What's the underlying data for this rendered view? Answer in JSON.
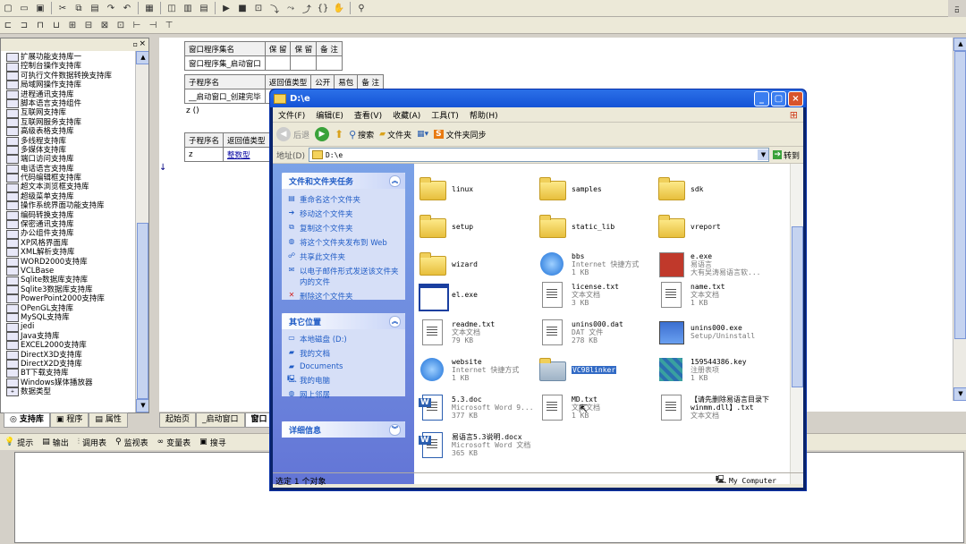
{
  "ide": {
    "tree_items": [
      "扩展功能支持库一",
      "控制台操作支持库",
      "可执行文件数据转换支持库",
      "局域网操作支持库",
      "进程通讯支持库",
      "脚本语言支持组件",
      "互联网支持库",
      "互联网服务支持库",
      "高级表格支持库",
      "多线程支持库",
      "多媒体支持库",
      "端口访问支持库",
      "电话语言支持库",
      "代码编辑框支持库",
      "超文本浏览框支持库",
      "超级菜单支持库",
      "操作系统界面功能支持库",
      "编码转换支持库",
      "保密通讯支持库",
      "办公组件支持库",
      "XP风格界面库",
      "XML解析支持库",
      "WORD2000支持库",
      "VCLBase",
      "Sqlite数据库支持库",
      "Sqlite3数据库支持库",
      "PowerPoint2000支持库",
      "OPenGL支持库",
      "MySQL支持库",
      "jedi",
      "Java支持库",
      "EXCEL2000支持库",
      "DirectX3D支持库",
      "DirectX2D支持库",
      "BT下载支持库",
      "Windows媒体播放器",
      "数据类型"
    ],
    "left_tabs": [
      "支持库",
      "程序",
      "属性"
    ],
    "code_tabs": [
      "起始页",
      "_启动窗口",
      "窗口"
    ],
    "table1": {
      "h": [
        "窗口程序集名",
        "保 留",
        "保 留",
        "备 注"
      ],
      "r": [
        "窗口程序集_启动窗口",
        "",
        "",
        ""
      ]
    },
    "table2": {
      "h": [
        "子程序名",
        "返回值类型",
        "公开",
        "易包",
        "备 注"
      ],
      "r": [
        "__启动窗口_创建完毕",
        "",
        "",
        "",
        ""
      ]
    },
    "code_line": "z ()",
    "table3": {
      "h": [
        "子程序名",
        "返回值类型"
      ],
      "r": [
        "z",
        "整数型"
      ]
    },
    "bottom_tabs": [
      "提示",
      "输出",
      "调用表",
      "监视表",
      "变量表",
      "搜寻"
    ]
  },
  "explorer": {
    "title": "D:\\e",
    "menu": [
      "文件(F)",
      "编辑(E)",
      "查看(V)",
      "收藏(A)",
      "工具(T)",
      "帮助(H)"
    ],
    "toolbar": {
      "back": "后退",
      "search": "搜索",
      "folders": "文件夹",
      "sync": "文件夹同步"
    },
    "address_label": "地址(D)",
    "address_value": "D:\\e",
    "go": "转到",
    "tasks_title": "文件和文件夹任务",
    "tasks": [
      "重命名这个文件夹",
      "移动这个文件夹",
      "复制这个文件夹",
      "将这个文件夹发布到 Web",
      "共享此文件夹",
      "以电子邮件形式发送该文件夹内的文件",
      "删除这个文件夹"
    ],
    "places_title": "其它位置",
    "places": [
      "本地磁盘 (D:)",
      "我的文档",
      "Documents",
      "我的电脑",
      "网上邻居"
    ],
    "details_title": "详细信息",
    "files": [
      {
        "n": "linux",
        "s1": "",
        "s2": "",
        "t": "folder"
      },
      {
        "n": "samples",
        "s1": "",
        "s2": "",
        "t": "folder"
      },
      {
        "n": "sdk",
        "s1": "",
        "s2": "",
        "t": "folder"
      },
      {
        "n": "setup",
        "s1": "",
        "s2": "",
        "t": "folder"
      },
      {
        "n": "static_lib",
        "s1": "",
        "s2": "",
        "t": "folder"
      },
      {
        "n": "vreport",
        "s1": "",
        "s2": "",
        "t": "folder"
      },
      {
        "n": "wizard",
        "s1": "",
        "s2": "",
        "t": "folder"
      },
      {
        "n": "bbs",
        "s1": "Internet 快捷方式",
        "s2": "1 KB",
        "t": "ie"
      },
      {
        "n": "e.exe",
        "s1": "易语言",
        "s2": "大有吴涛易语言软...",
        "t": "exe"
      },
      {
        "n": "el.exe",
        "s1": "",
        "s2": "",
        "t": "app"
      },
      {
        "n": "license.txt",
        "s1": "文本文档",
        "s2": "3 KB",
        "t": "doc"
      },
      {
        "n": "name.txt",
        "s1": "文本文档",
        "s2": "1 KB",
        "t": "doc"
      },
      {
        "n": "readme.txt",
        "s1": "文本文档",
        "s2": "79 KB",
        "t": "doc"
      },
      {
        "n": "unins000.dat",
        "s1": "DAT 文件",
        "s2": "278 KB",
        "t": "dat"
      },
      {
        "n": "unins000.exe",
        "s1": "Setup/Uninstall",
        "s2": "",
        "t": "setup"
      },
      {
        "n": "website",
        "s1": "Internet 快捷方式",
        "s2": "1 KB",
        "t": "ie"
      },
      {
        "n": "VC98linker",
        "s1": "",
        "s2": "",
        "t": "folder2"
      },
      {
        "n": "159544386.key",
        "s1": "注册表项",
        "s2": "1 KB",
        "t": "key"
      },
      {
        "n": "5.3.doc",
        "s1": "Microsoft Word 9...",
        "s2": "377 KB",
        "t": "word"
      },
      {
        "n": "MD.txt",
        "s1": "文本文档",
        "s2": "1 KB",
        "t": "doc"
      },
      {
        "n": "【请先删除易语言目录下winmm.dll】.txt",
        "s1": "文本文档",
        "s2": "",
        "t": "doc"
      },
      {
        "n": "易语言5.3说明.docx",
        "s1": "Microsoft Word 文档",
        "s2": "365 KB",
        "t": "word"
      }
    ],
    "status_left": "选定 1 个对象",
    "status_right": "My Computer"
  }
}
